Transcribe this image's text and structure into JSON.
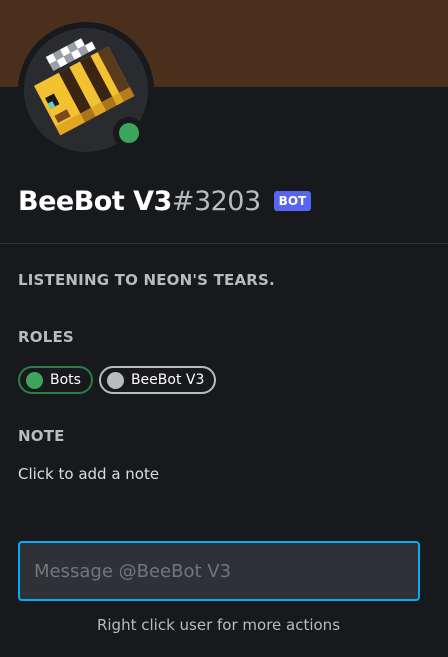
{
  "profile": {
    "username": "BeeBot V3",
    "discriminator": "#3203",
    "bot_tag": "BOT",
    "status_color": "#3ba55c",
    "activity": "LISTENING TO NEON'S TEARS."
  },
  "roles": {
    "title": "ROLES",
    "items": [
      {
        "name": "Bots",
        "color": "#3ba55c"
      },
      {
        "name": "BeeBot V3",
        "color": "#b9bbbe"
      }
    ]
  },
  "note": {
    "title": "NOTE",
    "placeholder": "Click to add a note"
  },
  "message": {
    "placeholder": "Message @BeeBot V3"
  },
  "footer": {
    "hint": "Right click user for more actions"
  },
  "colors": {
    "banner": "#4a301c",
    "accent": "#5865f2",
    "focus": "#00aff4"
  }
}
